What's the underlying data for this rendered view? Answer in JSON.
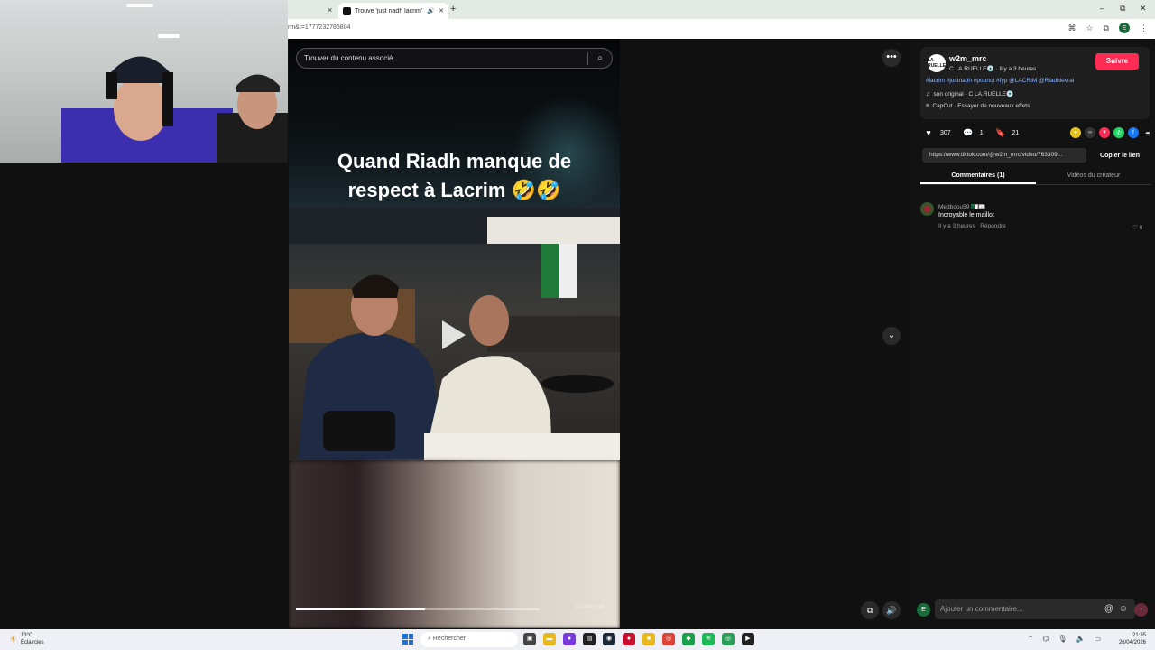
{
  "browser": {
    "prev_tab_close": "×",
    "active_tab_title": "Trouve 'just riadh lacrim' su",
    "new_tab": "+",
    "url": "rm&t=1777232786804",
    "window_controls": [
      "–",
      "⧉",
      "✕"
    ],
    "profile_initial": "E"
  },
  "video": {
    "search_placeholder": "Trouver du contenu associé",
    "caption_line1": "Quand Riadh manque de",
    "caption_line2": "respect à Lacrim 🤣🤣",
    "time": "01:45/01:56",
    "progress": 0.53
  },
  "panel": {
    "username": "w2m_mrc",
    "subtitle": "C LA.RUELLE💿 · Il y a 3 heures",
    "follow_label": "Suivre",
    "hashtags": "#lacrim #justriadh #pourtoi #fyp @LACRIM @Riadhlevrai",
    "music": "son original - C LA.RUELLE💿",
    "effect": "CapCut · Essayer de nouveaux effets",
    "likes": "307",
    "comments": "1",
    "saves": "21",
    "link": "https://www.tiktok.com/@w2m_mrc/video/763309...",
    "copy_link": "Copier le lien",
    "tab_comments": "Commentaires (1)",
    "tab_creator": "Vidéos du créateur",
    "comment_placeholder": "Ajouter un commentaire..."
  },
  "comments": [
    {
      "user": "Medboou59 🇩🇿📖",
      "text": "Incroyable le maillot",
      "time": "Il y a 3 heures",
      "reply": "Répondre",
      "likes": "0"
    }
  ],
  "taskbar": {
    "temperature": "13°C",
    "weather": "Éclaircies",
    "search_placeholder": "Rechercher",
    "time": "21:35",
    "date": "26/04/2026"
  },
  "colors": {
    "accent": "#fe2c55",
    "hashtag": "#8fb7ff"
  }
}
